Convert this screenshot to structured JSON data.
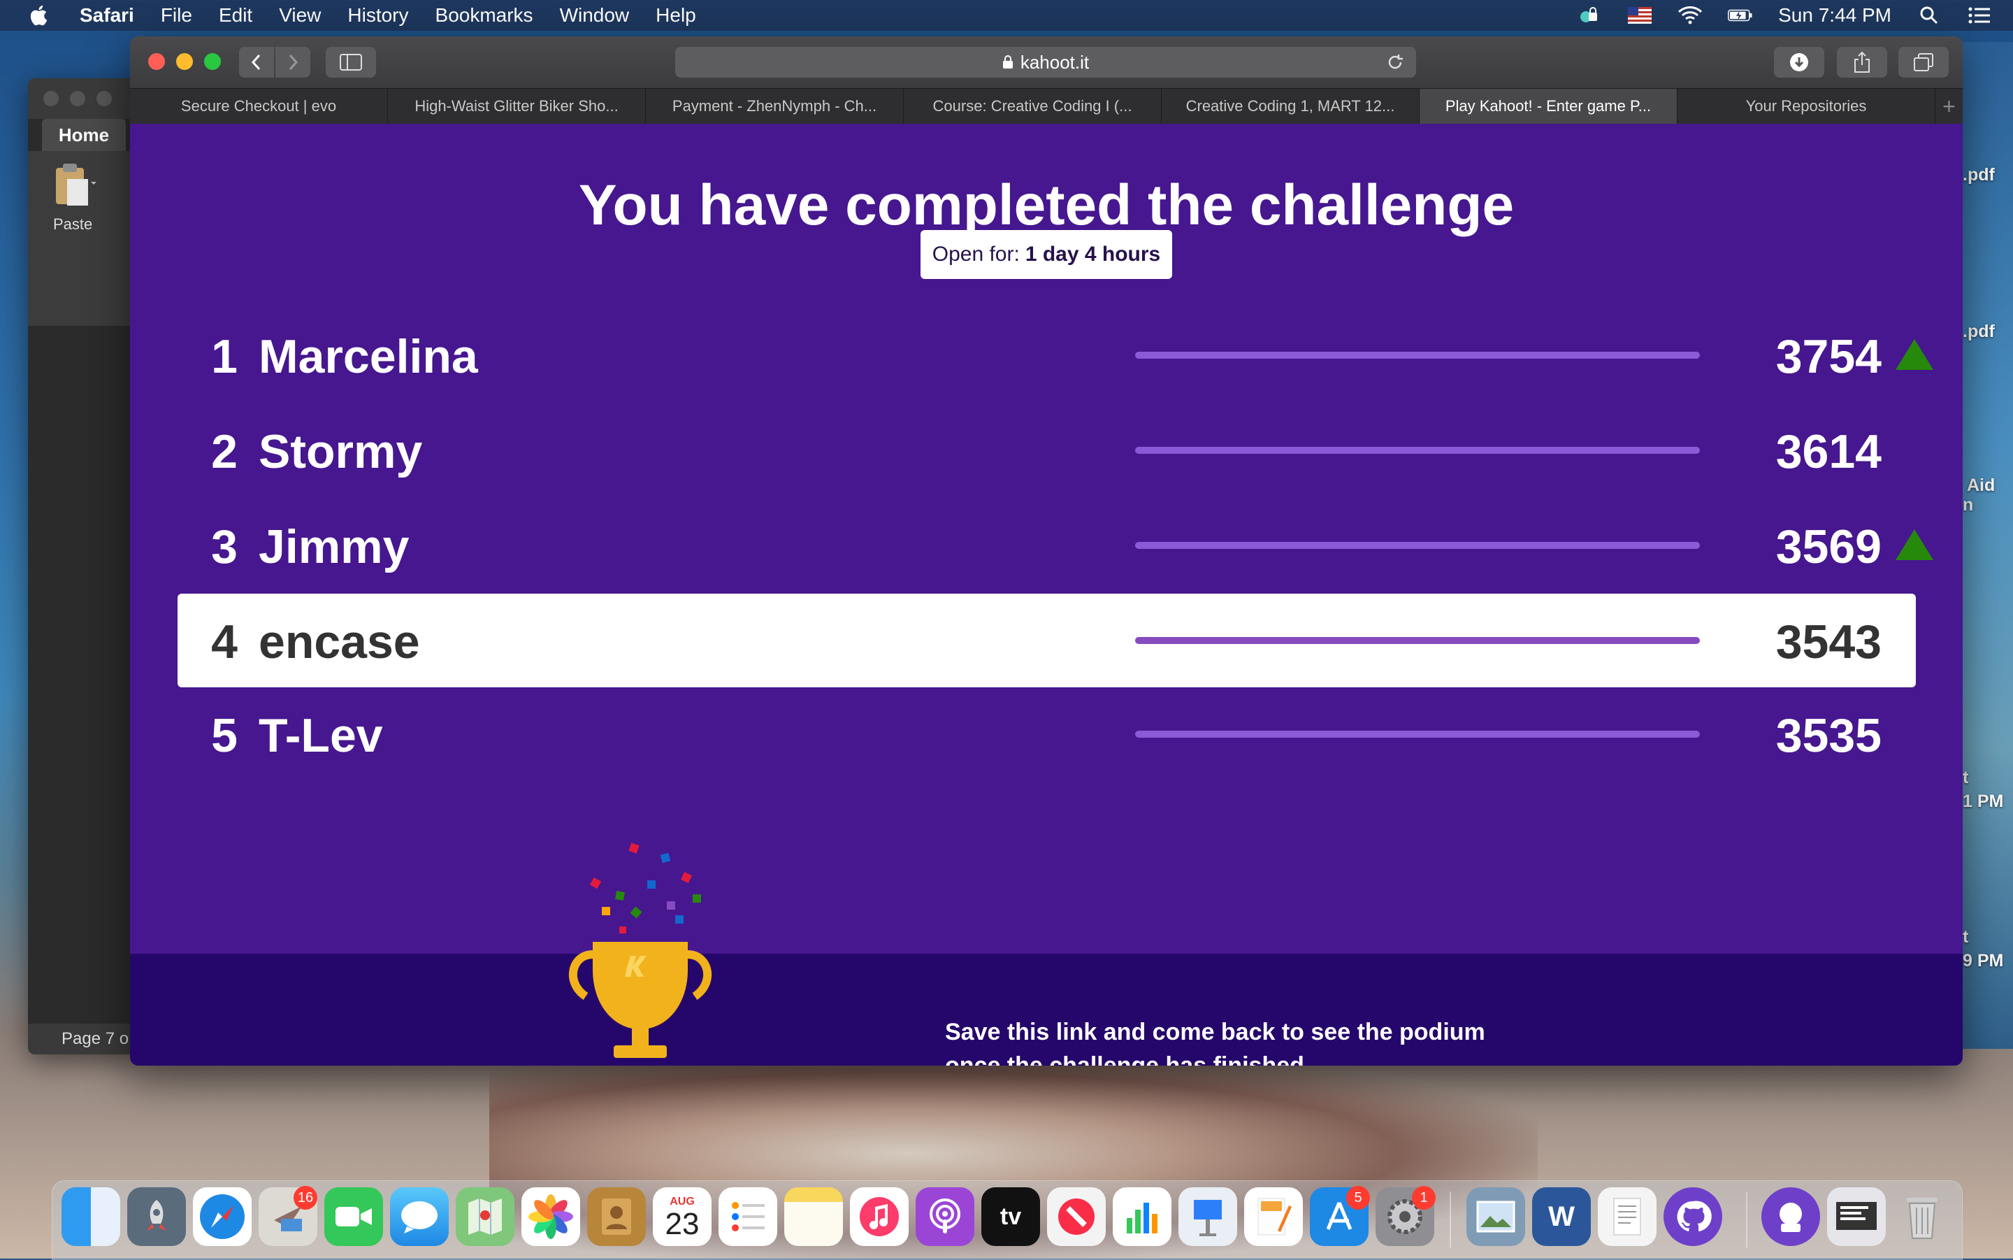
{
  "menubar": {
    "app": "Safari",
    "items": [
      "File",
      "Edit",
      "View",
      "History",
      "Bookmarks",
      "Window",
      "Help"
    ],
    "clock": "Sun 7:44 PM"
  },
  "desktop": {
    "labels": [
      ".pdf",
      ".pdf",
      "Aid",
      "n",
      "t",
      "1 PM",
      "t",
      "9 PM"
    ]
  },
  "background_window": {
    "home_tab": "Home",
    "paste_label": "Paste",
    "page_indicator": "Page 7 o"
  },
  "browser": {
    "url": "kahoot.it",
    "tabs": [
      {
        "label": "Secure Checkout | evo"
      },
      {
        "label": "High-Waist Glitter Biker Sho..."
      },
      {
        "label": "Payment - ZhenNymph - Ch..."
      },
      {
        "label": "Course: Creative Coding I (..."
      },
      {
        "label": "Creative Coding 1, MART 12..."
      },
      {
        "label": "Play Kahoot! - Enter game P...",
        "active": true
      },
      {
        "label": "Your Repositories"
      }
    ],
    "new_tab": "+"
  },
  "kahoot": {
    "title": "You have completed the challenge",
    "open_for_label": "Open for:",
    "open_for_value": "1 day 4 hours",
    "accent_color": "#46178f",
    "footer_color": "#25076b",
    "leaderboard": [
      {
        "rank": "1",
        "name": "Marcelina",
        "score": "3754",
        "trend": "up"
      },
      {
        "rank": "2",
        "name": "Stormy",
        "score": "3614",
        "trend": "none"
      },
      {
        "rank": "3",
        "name": "Jimmy",
        "score": "3569",
        "trend": "up"
      },
      {
        "rank": "4",
        "name": "encase",
        "score": "3543",
        "trend": "none",
        "highlighted": true
      },
      {
        "rank": "5",
        "name": "T-Lev",
        "score": "3535",
        "trend": "none"
      }
    ],
    "footer_line1": "Save this link and come back to see the podium",
    "footer_line2": "once the challenge has finished"
  },
  "dock": {
    "apps": [
      "finder-icon",
      "launchpad-icon",
      "safari-icon",
      "mail-icon",
      "facetime-icon",
      "messages-icon",
      "maps-icon",
      "photos-icon",
      "contacts-icon",
      "calendar-icon",
      "reminders-icon",
      "notes-icon",
      "music-icon",
      "podcasts-icon",
      "tv-icon",
      "news-icon",
      "numbers-icon",
      "keynote-icon",
      "pages-icon",
      "appstore-icon",
      "system-preferences-icon",
      "preview-icon",
      "word-icon",
      "textedit-icon",
      "github-icon",
      "github-desktop-icon",
      "screenshot-icon",
      "trash-icon"
    ],
    "calendar_month": "AUG",
    "calendar_day": "23",
    "tv_label": "tv",
    "word_label": "W",
    "badges": {
      "mail": "16",
      "appstore": "5",
      "system_preferences": "1"
    }
  }
}
